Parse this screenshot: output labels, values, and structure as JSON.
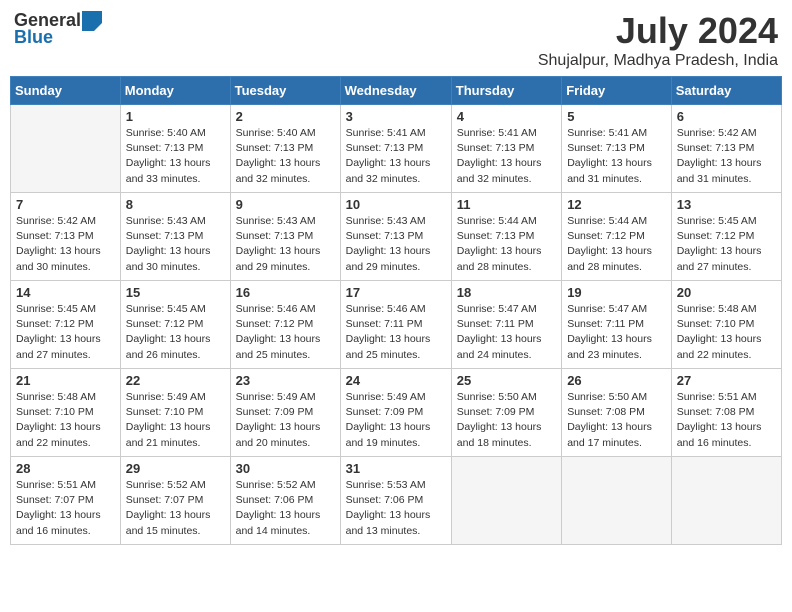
{
  "logo": {
    "general": "General",
    "blue": "Blue"
  },
  "title": {
    "month_year": "July 2024",
    "location": "Shujalpur, Madhya Pradesh, India"
  },
  "weekdays": [
    "Sunday",
    "Monday",
    "Tuesday",
    "Wednesday",
    "Thursday",
    "Friday",
    "Saturday"
  ],
  "weeks": [
    [
      {
        "day": "",
        "empty": true
      },
      {
        "day": "1",
        "sunrise": "Sunrise: 5:40 AM",
        "sunset": "Sunset: 7:13 PM",
        "daylight": "Daylight: 13 hours and 33 minutes."
      },
      {
        "day": "2",
        "sunrise": "Sunrise: 5:40 AM",
        "sunset": "Sunset: 7:13 PM",
        "daylight": "Daylight: 13 hours and 32 minutes."
      },
      {
        "day": "3",
        "sunrise": "Sunrise: 5:41 AM",
        "sunset": "Sunset: 7:13 PM",
        "daylight": "Daylight: 13 hours and 32 minutes."
      },
      {
        "day": "4",
        "sunrise": "Sunrise: 5:41 AM",
        "sunset": "Sunset: 7:13 PM",
        "daylight": "Daylight: 13 hours and 32 minutes."
      },
      {
        "day": "5",
        "sunrise": "Sunrise: 5:41 AM",
        "sunset": "Sunset: 7:13 PM",
        "daylight": "Daylight: 13 hours and 31 minutes."
      },
      {
        "day": "6",
        "sunrise": "Sunrise: 5:42 AM",
        "sunset": "Sunset: 7:13 PM",
        "daylight": "Daylight: 13 hours and 31 minutes."
      }
    ],
    [
      {
        "day": "7",
        "sunrise": "Sunrise: 5:42 AM",
        "sunset": "Sunset: 7:13 PM",
        "daylight": "Daylight: 13 hours and 30 minutes."
      },
      {
        "day": "8",
        "sunrise": "Sunrise: 5:43 AM",
        "sunset": "Sunset: 7:13 PM",
        "daylight": "Daylight: 13 hours and 30 minutes."
      },
      {
        "day": "9",
        "sunrise": "Sunrise: 5:43 AM",
        "sunset": "Sunset: 7:13 PM",
        "daylight": "Daylight: 13 hours and 29 minutes."
      },
      {
        "day": "10",
        "sunrise": "Sunrise: 5:43 AM",
        "sunset": "Sunset: 7:13 PM",
        "daylight": "Daylight: 13 hours and 29 minutes."
      },
      {
        "day": "11",
        "sunrise": "Sunrise: 5:44 AM",
        "sunset": "Sunset: 7:13 PM",
        "daylight": "Daylight: 13 hours and 28 minutes."
      },
      {
        "day": "12",
        "sunrise": "Sunrise: 5:44 AM",
        "sunset": "Sunset: 7:12 PM",
        "daylight": "Daylight: 13 hours and 28 minutes."
      },
      {
        "day": "13",
        "sunrise": "Sunrise: 5:45 AM",
        "sunset": "Sunset: 7:12 PM",
        "daylight": "Daylight: 13 hours and 27 minutes."
      }
    ],
    [
      {
        "day": "14",
        "sunrise": "Sunrise: 5:45 AM",
        "sunset": "Sunset: 7:12 PM",
        "daylight": "Daylight: 13 hours and 27 minutes."
      },
      {
        "day": "15",
        "sunrise": "Sunrise: 5:45 AM",
        "sunset": "Sunset: 7:12 PM",
        "daylight": "Daylight: 13 hours and 26 minutes."
      },
      {
        "day": "16",
        "sunrise": "Sunrise: 5:46 AM",
        "sunset": "Sunset: 7:12 PM",
        "daylight": "Daylight: 13 hours and 25 minutes."
      },
      {
        "day": "17",
        "sunrise": "Sunrise: 5:46 AM",
        "sunset": "Sunset: 7:11 PM",
        "daylight": "Daylight: 13 hours and 25 minutes."
      },
      {
        "day": "18",
        "sunrise": "Sunrise: 5:47 AM",
        "sunset": "Sunset: 7:11 PM",
        "daylight": "Daylight: 13 hours and 24 minutes."
      },
      {
        "day": "19",
        "sunrise": "Sunrise: 5:47 AM",
        "sunset": "Sunset: 7:11 PM",
        "daylight": "Daylight: 13 hours and 23 minutes."
      },
      {
        "day": "20",
        "sunrise": "Sunrise: 5:48 AM",
        "sunset": "Sunset: 7:10 PM",
        "daylight": "Daylight: 13 hours and 22 minutes."
      }
    ],
    [
      {
        "day": "21",
        "sunrise": "Sunrise: 5:48 AM",
        "sunset": "Sunset: 7:10 PM",
        "daylight": "Daylight: 13 hours and 22 minutes."
      },
      {
        "day": "22",
        "sunrise": "Sunrise: 5:49 AM",
        "sunset": "Sunset: 7:10 PM",
        "daylight": "Daylight: 13 hours and 21 minutes."
      },
      {
        "day": "23",
        "sunrise": "Sunrise: 5:49 AM",
        "sunset": "Sunset: 7:09 PM",
        "daylight": "Daylight: 13 hours and 20 minutes."
      },
      {
        "day": "24",
        "sunrise": "Sunrise: 5:49 AM",
        "sunset": "Sunset: 7:09 PM",
        "daylight": "Daylight: 13 hours and 19 minutes."
      },
      {
        "day": "25",
        "sunrise": "Sunrise: 5:50 AM",
        "sunset": "Sunset: 7:09 PM",
        "daylight": "Daylight: 13 hours and 18 minutes."
      },
      {
        "day": "26",
        "sunrise": "Sunrise: 5:50 AM",
        "sunset": "Sunset: 7:08 PM",
        "daylight": "Daylight: 13 hours and 17 minutes."
      },
      {
        "day": "27",
        "sunrise": "Sunrise: 5:51 AM",
        "sunset": "Sunset: 7:08 PM",
        "daylight": "Daylight: 13 hours and 16 minutes."
      }
    ],
    [
      {
        "day": "28",
        "sunrise": "Sunrise: 5:51 AM",
        "sunset": "Sunset: 7:07 PM",
        "daylight": "Daylight: 13 hours and 16 minutes."
      },
      {
        "day": "29",
        "sunrise": "Sunrise: 5:52 AM",
        "sunset": "Sunset: 7:07 PM",
        "daylight": "Daylight: 13 hours and 15 minutes."
      },
      {
        "day": "30",
        "sunrise": "Sunrise: 5:52 AM",
        "sunset": "Sunset: 7:06 PM",
        "daylight": "Daylight: 13 hours and 14 minutes."
      },
      {
        "day": "31",
        "sunrise": "Sunrise: 5:53 AM",
        "sunset": "Sunset: 7:06 PM",
        "daylight": "Daylight: 13 hours and 13 minutes."
      },
      {
        "day": "",
        "empty": true
      },
      {
        "day": "",
        "empty": true
      },
      {
        "day": "",
        "empty": true
      }
    ]
  ]
}
